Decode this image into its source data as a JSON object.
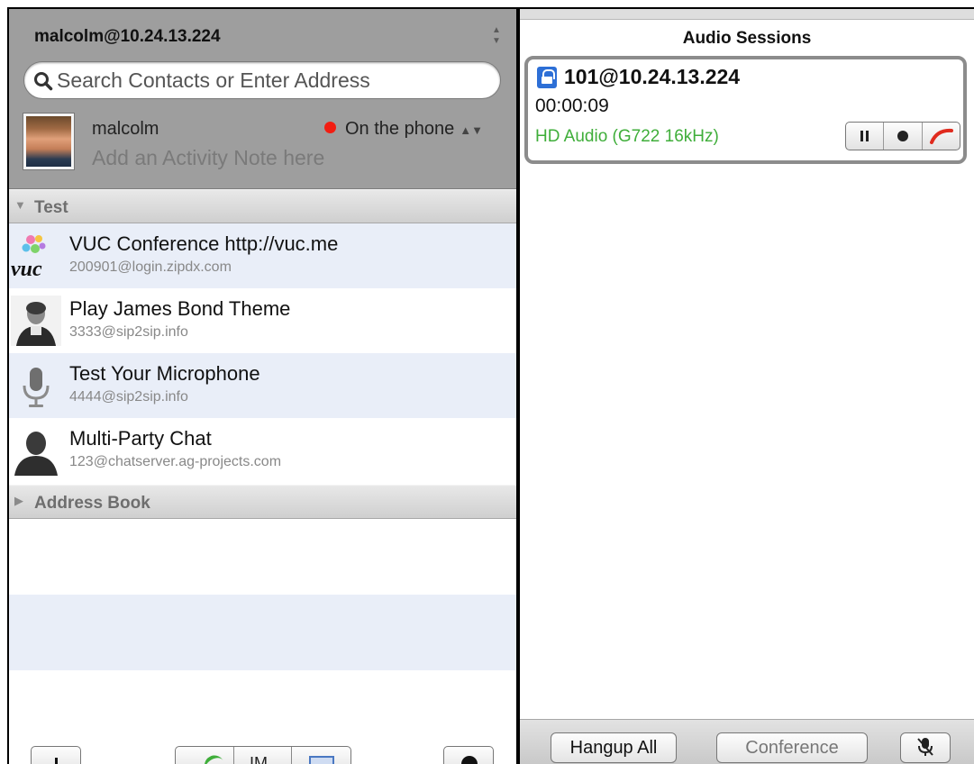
{
  "account": {
    "selected": "malcolm@10.24.13.224"
  },
  "search": {
    "placeholder": "Search Contacts or Enter Address"
  },
  "me": {
    "name": "malcolm",
    "activity_note_placeholder": "Add an Activity Note here",
    "presence": "On the phone",
    "presence_color": "#f21d12"
  },
  "groups": [
    {
      "name": "Test",
      "expanded": true,
      "contacts": [
        {
          "name": "VUC Conference http://vuc.me",
          "address": "200901@login.zipdx.com",
          "icon": "vuc-logo-icon"
        },
        {
          "name": "Play James Bond Theme",
          "address": "3333@sip2sip.info",
          "icon": "person-photo-icon"
        },
        {
          "name": "Test Your Microphone",
          "address": "4444@sip2sip.info",
          "icon": "microphone-icon"
        },
        {
          "name": "Multi-Party Chat",
          "address": "123@chatserver.ag-projects.com",
          "icon": "person-silhouette-icon"
        }
      ]
    },
    {
      "name": "Address Book",
      "expanded": false
    }
  ],
  "audio_sessions": {
    "title": "Audio Sessions",
    "session": {
      "address": "101@10.24.13.224",
      "duration": "00:00:09",
      "codec": "HD Audio (G722 16kHz)",
      "codec_color": "#3fae3a",
      "encrypted": true
    },
    "buttons": {
      "hangup_all": "Hangup All",
      "conference": "Conference"
    }
  },
  "left_toolbar": {
    "im_label": "IM"
  }
}
